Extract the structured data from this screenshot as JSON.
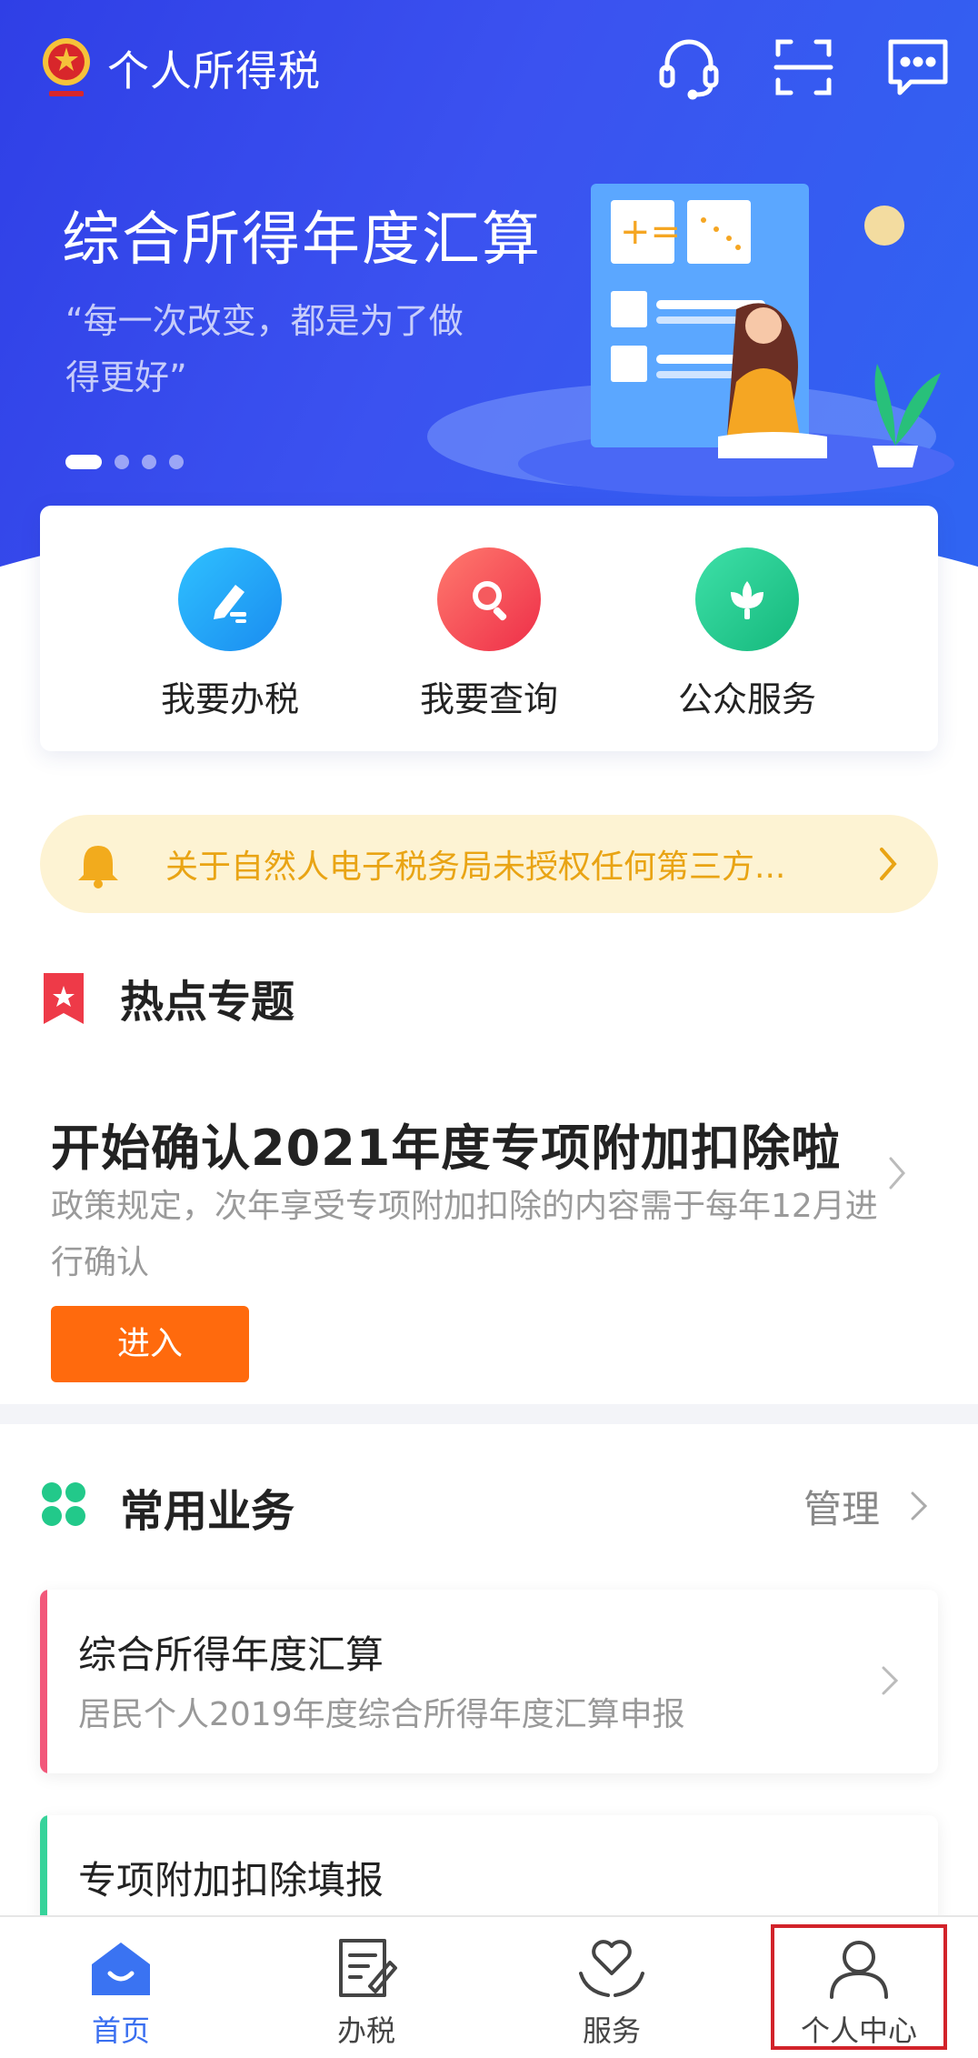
{
  "app": {
    "title": "个人所得税"
  },
  "banner": {
    "title": "综合所得年度汇算",
    "subtitle": "“每一次改变，都是为了做得更好”",
    "page_count": 4,
    "active_page": 1
  },
  "quick_actions": [
    {
      "label": "我要办税",
      "icon": "pen-icon",
      "color": "#1aa2f0"
    },
    {
      "label": "我要查询",
      "icon": "magnifier-icon",
      "color": "#f2484f"
    },
    {
      "label": "公众服务",
      "icon": "lotus-icon",
      "color": "#1fc58f"
    }
  ],
  "notice": {
    "text": "关于自然人电子税务局未授权任何第三方..."
  },
  "hot_topics": {
    "title": "热点专题",
    "item": {
      "title": "开始确认2021年度专项附加扣除啦",
      "desc": "政策规定，次年享受专项附加扣除的内容需于每年12月进行确认",
      "button": "进入"
    }
  },
  "common": {
    "title": "常用业务",
    "manage": "管理",
    "items": [
      {
        "title": "综合所得年度汇算",
        "subtitle": "居民个人2019年度综合所得年度汇算申报",
        "color": "#f2577a"
      },
      {
        "title": "专项附加扣除填报",
        "subtitle": "",
        "color": "#36d39a"
      }
    ]
  },
  "nav": [
    {
      "label": "首页",
      "icon": "home-icon",
      "active": true
    },
    {
      "label": "办税",
      "icon": "tax-doc-icon",
      "active": false
    },
    {
      "label": "服务",
      "icon": "heart-hands-icon",
      "active": false
    },
    {
      "label": "个人中心",
      "icon": "person-icon",
      "active": false
    }
  ],
  "colors": {
    "accent": "#3a6ff0",
    "orange": "#ff6a0d",
    "notice": "#e9a414"
  }
}
